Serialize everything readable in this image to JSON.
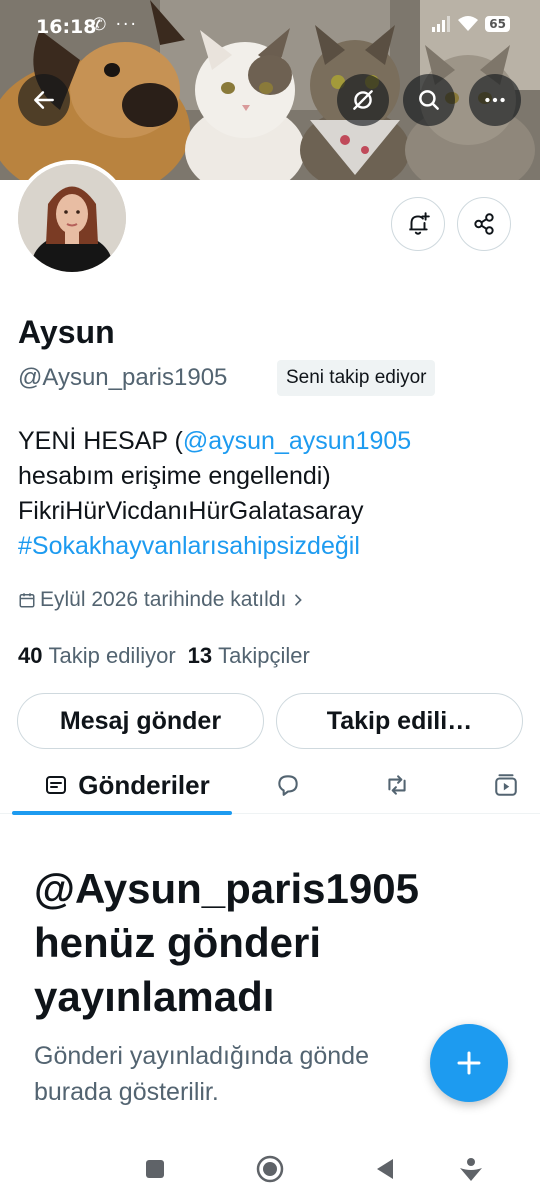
{
  "status_bar": {
    "time": "16:18",
    "left_icons": [
      "whatsapp-icon",
      "more-notifications-icon"
    ],
    "left_glyphs": "✆ ···",
    "battery": "65"
  },
  "top_bar": {
    "icons": [
      "back-arrow-icon",
      "translate-off-icon",
      "search-icon",
      "more-icon"
    ]
  },
  "profile": {
    "name": "Aysun",
    "handle": "@Aysun_paris1905",
    "follows_you_badge": "Seni takip ediyor",
    "bio": {
      "line1_text": "YENİ HESAP (",
      "line1_link": "@aysun_aysun1905",
      "line2": "hesabım erişime engellendi)",
      "line3": "FikriHürVicdanıHürGalatasaray",
      "line4_hashtag": "#Sokakhayvanlarısahipsizdeğil"
    },
    "joined": "Eylül 2026 tarihinde katıldı",
    "following_count": "40",
    "following_label": "Takip ediliyor",
    "followers_count": "13",
    "followers_label": "Takipçiler"
  },
  "actions": {
    "message_button": "Mesaj gönder",
    "following_button": "Takip edili…"
  },
  "tabs": {
    "active_label": "Gönderiler",
    "icons": [
      "posts-icon",
      "replies-icon",
      "reposts-icon",
      "media-icon"
    ]
  },
  "empty_state": {
    "title": "@Aysun_paris1905 henüz gönderi yayınlamadı",
    "subtitle": "Gönderi yayınladığında gönde burada gösterilir."
  },
  "colors": {
    "accent": "#1d9bf0",
    "text_primary": "#0f1419",
    "text_secondary": "#536471",
    "border": "#cfd9de"
  },
  "android_nav": [
    "recent-apps-icon",
    "home-icon",
    "back-icon",
    "assistant-icon"
  ]
}
